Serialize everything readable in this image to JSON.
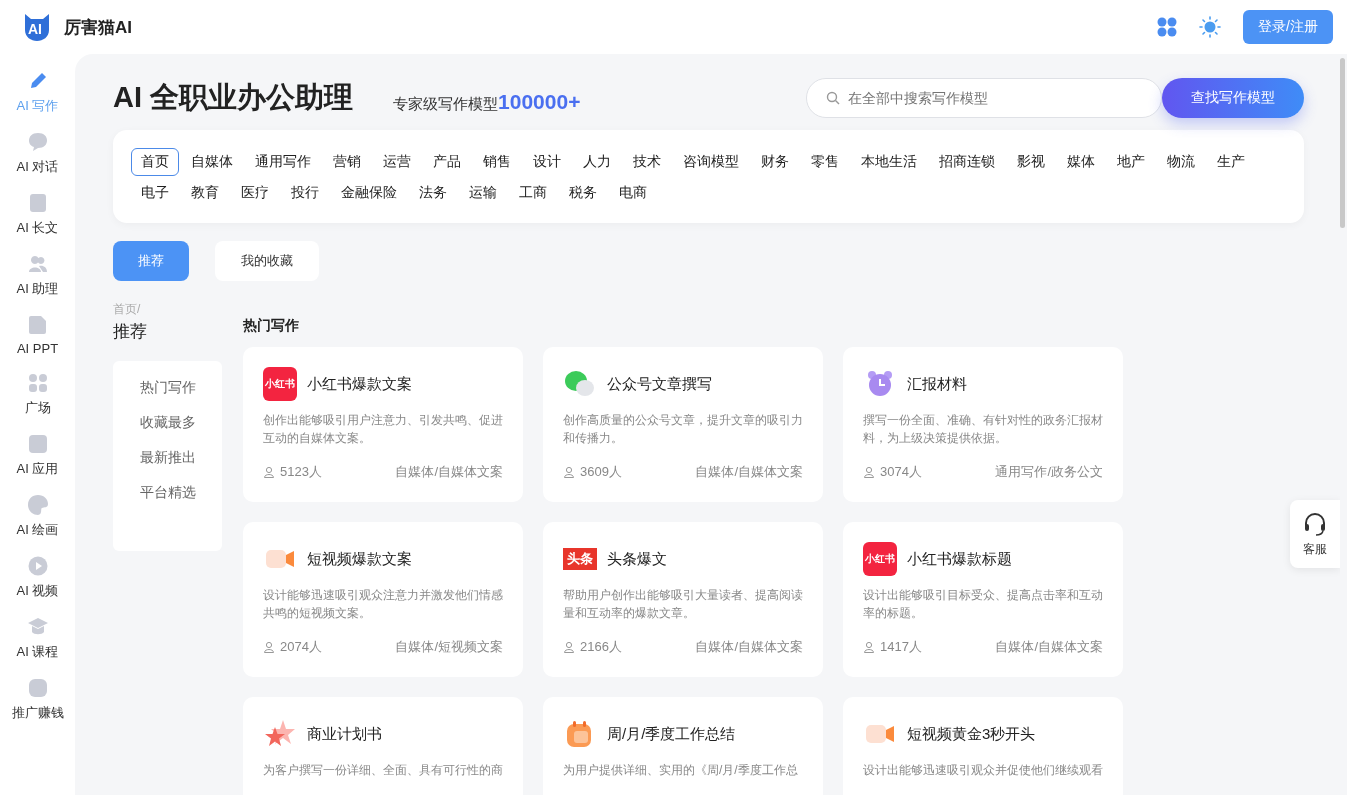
{
  "header": {
    "brand": "厉害猫AI",
    "logo_text": "AI",
    "login_button": "登录/注册"
  },
  "sidebar": {
    "items": [
      {
        "label": "AI 写作",
        "kind": "pencil",
        "selected": true
      },
      {
        "label": "AI 对话",
        "kind": "chat",
        "selected": false
      },
      {
        "label": "AI 长文",
        "kind": "doc",
        "selected": false
      },
      {
        "label": "AI 助理",
        "kind": "people",
        "selected": false
      },
      {
        "label": "AI PPT",
        "kind": "ppt",
        "selected": false
      },
      {
        "label": "广场",
        "kind": "grid",
        "selected": false
      },
      {
        "label": "AI 应用",
        "kind": "app",
        "selected": false
      },
      {
        "label": "AI 绘画",
        "kind": "palette",
        "selected": false
      },
      {
        "label": "AI 视频",
        "kind": "play",
        "selected": false
      },
      {
        "label": "AI 课程",
        "kind": "cap",
        "selected": false
      },
      {
        "label": "推广赚钱",
        "kind": "group",
        "selected": false
      }
    ]
  },
  "hero": {
    "title": "AI 全职业办公助理",
    "subtitle": "专家级写作模型",
    "count": "100000+",
    "search": {
      "placeholder": "在全部中搜索写作模型"
    },
    "search_button": "查找写作模型"
  },
  "categories": [
    {
      "label": "首页",
      "selected": true
    },
    {
      "label": "自媒体",
      "selected": false
    },
    {
      "label": "通用写作",
      "selected": false
    },
    {
      "label": "营销",
      "selected": false
    },
    {
      "label": "运营",
      "selected": false
    },
    {
      "label": "产品",
      "selected": false
    },
    {
      "label": "销售",
      "selected": false
    },
    {
      "label": "设计",
      "selected": false
    },
    {
      "label": "人力",
      "selected": false
    },
    {
      "label": "技术",
      "selected": false
    },
    {
      "label": "咨询模型",
      "selected": false
    },
    {
      "label": "财务",
      "selected": false
    },
    {
      "label": "零售",
      "selected": false
    },
    {
      "label": "本地生活",
      "selected": false
    },
    {
      "label": "招商连锁",
      "selected": false
    },
    {
      "label": "影视",
      "selected": false
    },
    {
      "label": "媒体",
      "selected": false
    },
    {
      "label": "地产",
      "selected": false
    },
    {
      "label": "物流",
      "selected": false
    },
    {
      "label": "生产",
      "selected": false
    },
    {
      "label": "电子",
      "selected": false
    },
    {
      "label": "教育",
      "selected": false
    },
    {
      "label": "医疗",
      "selected": false
    },
    {
      "label": "投行",
      "selected": false
    },
    {
      "label": "金融保险",
      "selected": false
    },
    {
      "label": "法务",
      "selected": false
    },
    {
      "label": "运输",
      "selected": false
    },
    {
      "label": "工商",
      "selected": false
    },
    {
      "label": "税务",
      "selected": false
    },
    {
      "label": "电商",
      "selected": false
    }
  ],
  "tabs": [
    {
      "label": "推荐",
      "selected": true
    },
    {
      "label": "我的收藏",
      "selected": false
    }
  ],
  "breadcrumb": {
    "path": "首页/",
    "current": "推荐"
  },
  "side_menu": [
    "热门写作",
    "收藏最多",
    "最新推出",
    "平台精选"
  ],
  "section_title": "热门写作",
  "cards": [
    {
      "kind": "xhs",
      "icon_text": "小红书",
      "title": "小红书爆款文案",
      "desc": "创作出能够吸引用户注意力、引发共鸣、促进互动的自媒体文案。",
      "users": "5123人",
      "tag": "自媒体/自媒体文案"
    },
    {
      "kind": "wechat",
      "title": "公众号文章撰写",
      "desc": "创作高质量的公众号文章，提升文章的吸引力和传播力。",
      "users": "3609人",
      "tag": "自媒体/自媒体文案"
    },
    {
      "kind": "clock",
      "title": "汇报材料",
      "desc": "撰写一份全面、准确、有针对性的政务汇报材料，为上级决策提供依据。",
      "users": "3074人",
      "tag": "通用写作/政务公文"
    },
    {
      "kind": "video",
      "title": "短视频爆款文案",
      "desc": "设计能够迅速吸引观众注意力并激发他们情感共鸣的短视频文案。",
      "users": "2074人",
      "tag": "自媒体/短视频文案"
    },
    {
      "kind": "toutiao",
      "icon_text": "头条",
      "title": "头条爆文",
      "desc": "帮助用户创作出能够吸引大量读者、提高阅读量和互动率的爆款文章。",
      "users": "2166人",
      "tag": "自媒体/自媒体文案"
    },
    {
      "kind": "xhs",
      "icon_text": "小红书",
      "title": "小红书爆款标题",
      "desc": "设计出能够吸引目标受众、提高点击率和互动率的标题。",
      "users": "1417人",
      "tag": "自媒体/自媒体文案"
    },
    {
      "kind": "star",
      "title": "商业计划书",
      "desc": "为客户撰写一份详细、全面、具有可行性的商"
    },
    {
      "kind": "calendar",
      "title": "周/月/季度工作总结",
      "desc": "为用户提供详细、实用的《周/月/季度工作总"
    },
    {
      "kind": "video",
      "title": "短视频黄金3秒开头",
      "desc": "设计出能够迅速吸引观众并促使他们继续观看"
    }
  ],
  "support": {
    "label": "客服"
  }
}
